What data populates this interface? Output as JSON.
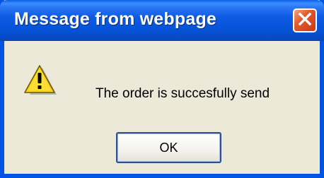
{
  "dialog": {
    "title": "Message from webpage",
    "message": "The order is succesfully send",
    "ok_label": "OK",
    "icon": "warning-icon",
    "close_icon": "close-icon"
  },
  "colors": {
    "titlebar": "#0054e3",
    "body": "#ece9d8",
    "close_button": "#e2592c",
    "warning_yellow": "#f7d417"
  }
}
